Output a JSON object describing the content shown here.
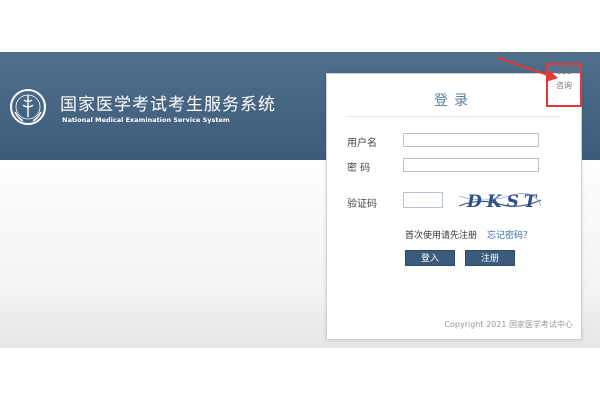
{
  "header": {
    "title": "国家医学考试考生服务系统",
    "subtitle": "National Medical Examination Service System"
  },
  "login": {
    "title": "登录",
    "username_label": "用户名",
    "password_label": "密 码",
    "captcha_label": "验证码",
    "captcha_text": "DKST",
    "register_link": "首次使用请先注册",
    "forgot_link": "忘记密码？",
    "login_button": "登入",
    "register_button": "注册",
    "copyright": "Copyright 2021 国家医学考试中心"
  },
  "corner": {
    "text": "咨询"
  },
  "colors": {
    "header_bg": "#4a6a88",
    "button_bg": "#3b5b7c",
    "annotation": "#e53935"
  }
}
